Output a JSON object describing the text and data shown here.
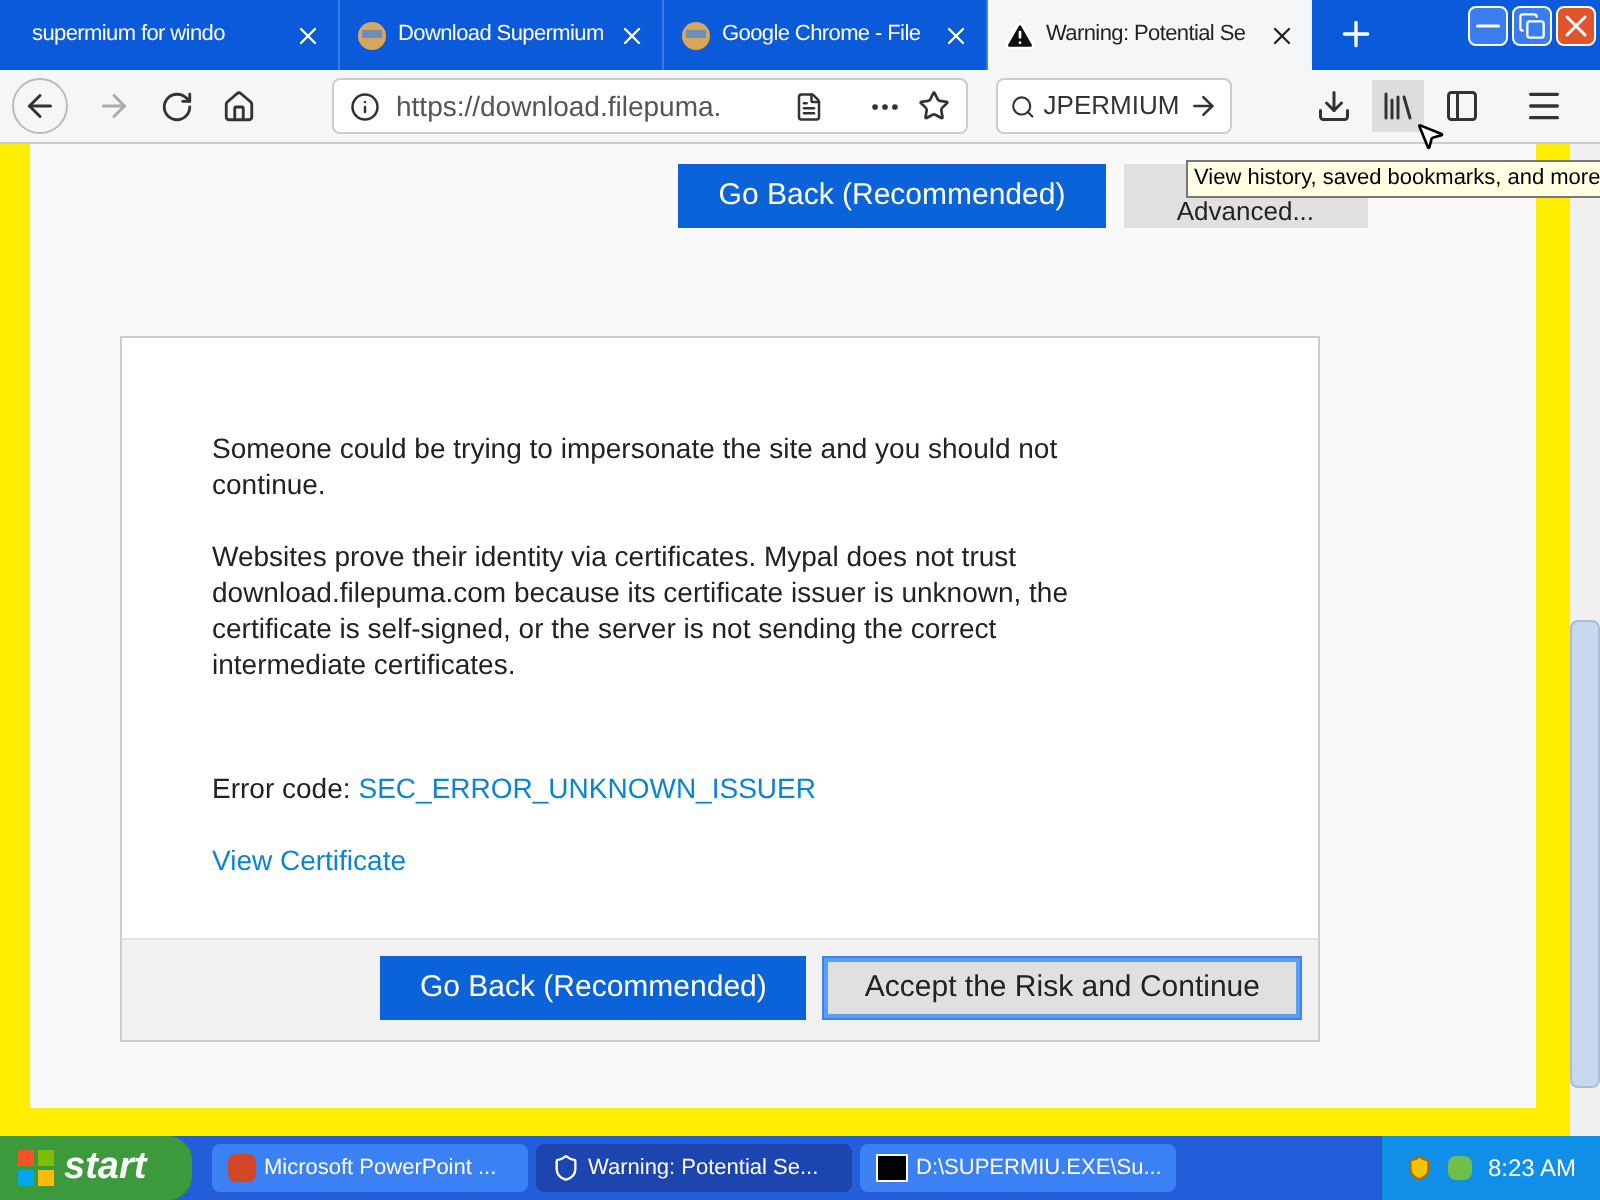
{
  "tabs": [
    {
      "label": "supermium for windo",
      "selected": false,
      "kind": "plain"
    },
    {
      "label": "Download Supermium",
      "selected": false,
      "kind": "site"
    },
    {
      "label": "Google Chrome - File",
      "selected": false,
      "kind": "site"
    },
    {
      "label": "Warning: Potential Se",
      "selected": true,
      "kind": "warning"
    }
  ],
  "address": {
    "value": "https://download.filepuma."
  },
  "search": {
    "value": "JPERMIUM"
  },
  "tooltip": "View history, saved bookmarks, and more",
  "top_buttons": [
    {
      "label": "Go Back (Recommended)",
      "kind": "primary"
    },
    {
      "label": "Advanced...",
      "kind": "secondary"
    }
  ],
  "panel": {
    "paragraphs": [
      "Someone could be trying to impersonate the site and you should not continue.",
      "Websites prove their identity via certificates. Mypal does not trust download.filepuma.com because its certificate issuer is unknown, the certificate is self-signed, or the server is not sending the correct intermediate certificates."
    ],
    "error_label": "Error code:",
    "error_code": "SEC_ERROR_UNKNOWN_ISSUER",
    "view_certificate": "View Certificate",
    "buttons": [
      {
        "label": "Go Back (Recommended)",
        "kind": "primary"
      },
      {
        "label": "Accept the Risk and Continue",
        "kind": "secondary"
      }
    ]
  },
  "taskbar": {
    "start": "start",
    "tasks": [
      {
        "label": "Microsoft PowerPoint ...",
        "selected": false,
        "kind": "presentation"
      },
      {
        "label": "Warning: Potential Se...",
        "selected": true,
        "kind": "browser"
      },
      {
        "label": "D:\\SUPERMIU.EXE\\Su...",
        "selected": false,
        "kind": "archive"
      }
    ],
    "time": "8:23 AM"
  }
}
